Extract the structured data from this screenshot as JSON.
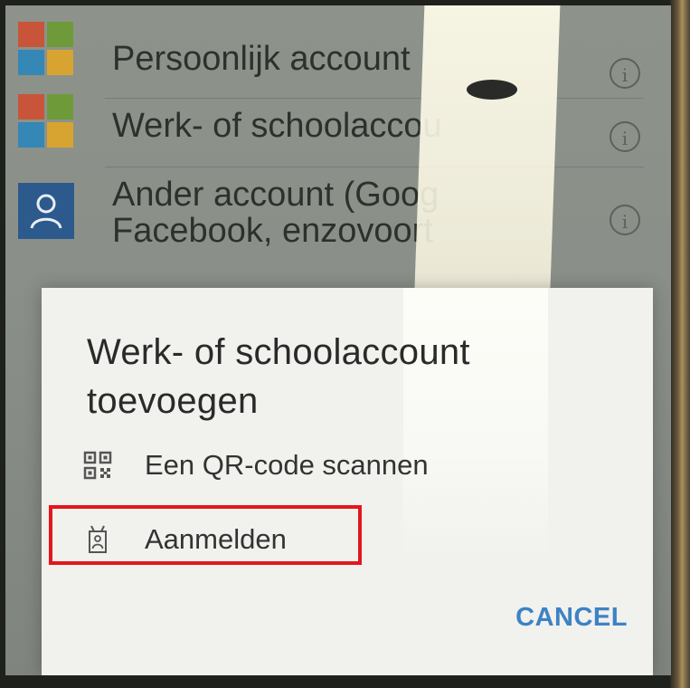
{
  "account_list": {
    "items": [
      {
        "label": "Persoonlijk account",
        "icon": "microsoft-logo-icon"
      },
      {
        "label": "Werk- of schoolaccou",
        "icon": "microsoft-logo-icon"
      },
      {
        "label_line1": "Ander account (Goog",
        "label_line2": "Facebook, enzovoort",
        "icon": "person-icon"
      }
    ],
    "info_glyph": "i"
  },
  "dialog": {
    "title": "Werk- of schoolaccount toevoegen",
    "options": [
      {
        "label": "Een QR-code scannen",
        "icon": "qr-code-icon"
      },
      {
        "label": "Aanmelden",
        "icon": "badge-icon"
      }
    ],
    "cancel_label": "CANCEL"
  },
  "colors": {
    "accent": "#3d82c4",
    "highlight": "#e3171d",
    "person_tile": "#2d5a8d"
  }
}
